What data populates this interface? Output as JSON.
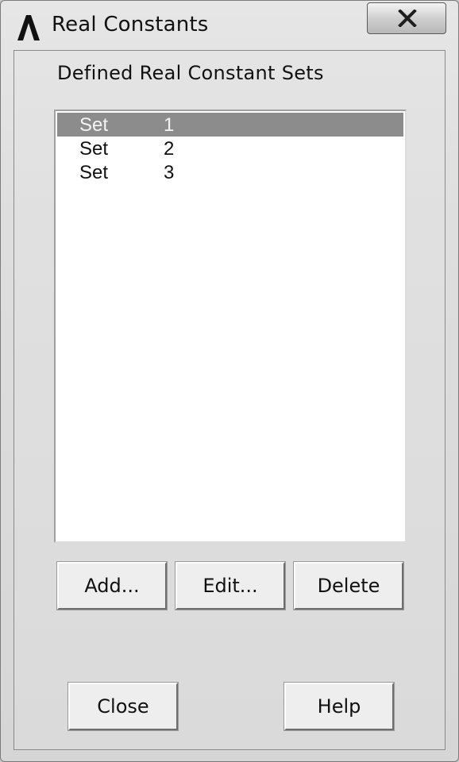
{
  "window": {
    "title": "Real Constants",
    "icon": "ansys-logo-icon",
    "close_icon": "close-x-icon"
  },
  "section": {
    "label": "Defined Real Constant Sets"
  },
  "list": {
    "items": [
      {
        "name": "Set",
        "number": "1",
        "selected": true
      },
      {
        "name": "Set",
        "number": "2",
        "selected": false
      },
      {
        "name": "Set",
        "number": "3",
        "selected": false
      }
    ]
  },
  "buttons": {
    "add": "Add...",
    "edit": "Edit...",
    "delete": "Delete",
    "close": "Close",
    "help": "Help"
  },
  "colors": {
    "selection": "#8c8c8c",
    "list_background": "#ffffff",
    "dialog_background": "#e0e0e0"
  }
}
